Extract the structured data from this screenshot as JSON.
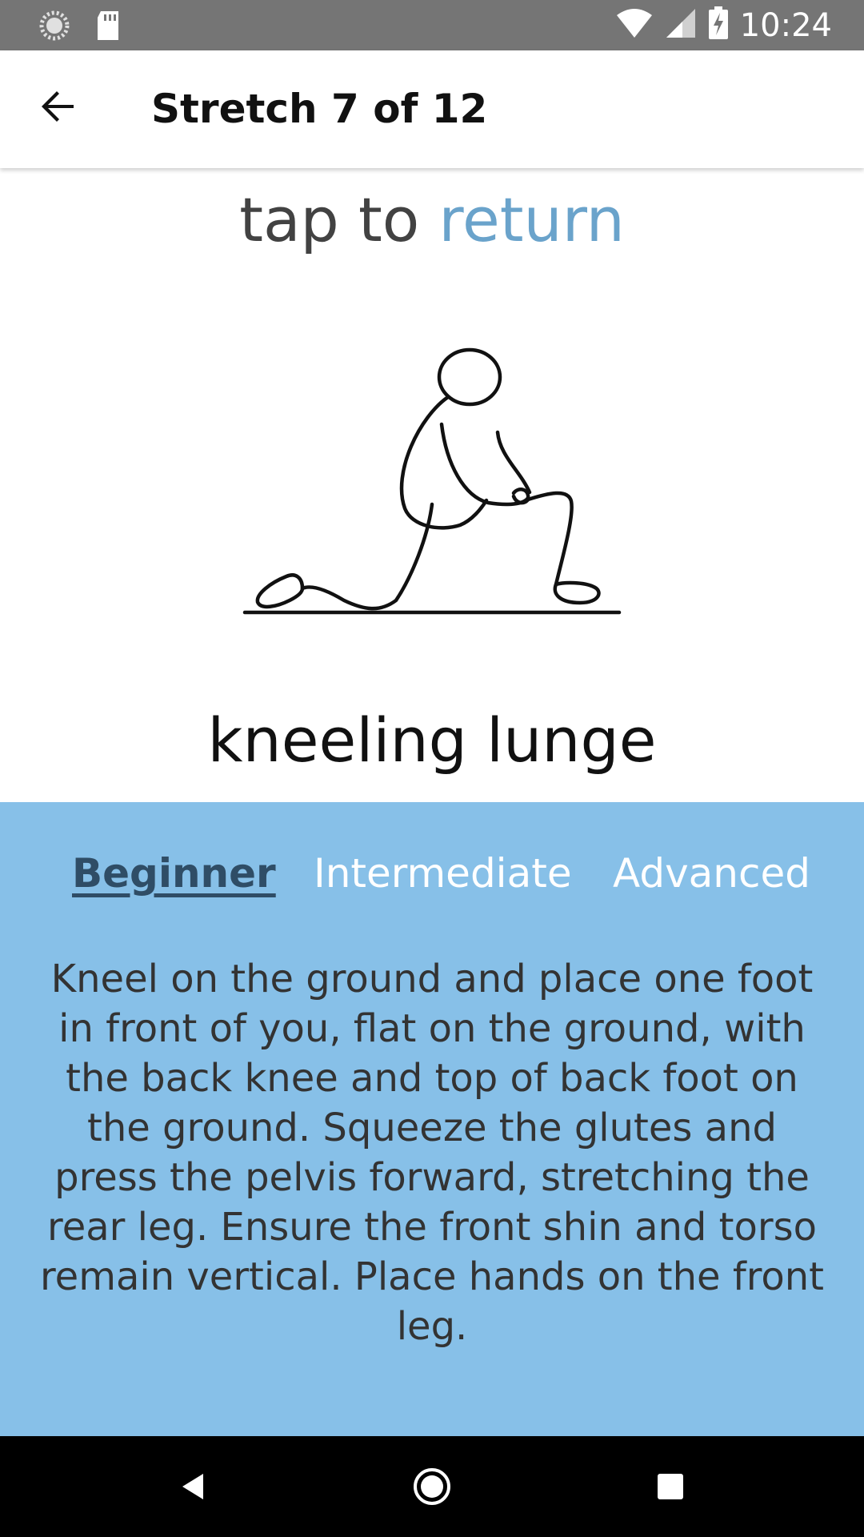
{
  "status_bar": {
    "time": "10:24",
    "icons": [
      "sync-icon",
      "sd-card-icon",
      "wifi-icon",
      "signal-icon",
      "battery-charging-icon"
    ]
  },
  "app_bar": {
    "back_icon": "arrow-back-icon",
    "title": "Stretch 7 of 12"
  },
  "header": {
    "prefix": "tap to ",
    "link": "return",
    "link_color": "#6aa3cb"
  },
  "exercise": {
    "name": "kneeling lunge",
    "illustration": "kneeling-lunge-figure"
  },
  "levels": {
    "tabs": [
      {
        "label": "Beginner",
        "active": true
      },
      {
        "label": "Intermediate",
        "active": false
      },
      {
        "label": "Advanced",
        "active": false
      }
    ],
    "panel_color": "#87c0e8"
  },
  "description": "Kneel on the ground and place one foot in front of you, flat on the ground, with the back knee and top of back foot on the ground. Squeeze the glutes and press the pelvis forward, stretching the rear leg. Ensure the front shin and torso remain vertical. Place hands on the front leg.",
  "nav_bar": {
    "icons": [
      "nav-back-icon",
      "nav-home-icon",
      "nav-recents-icon"
    ]
  }
}
